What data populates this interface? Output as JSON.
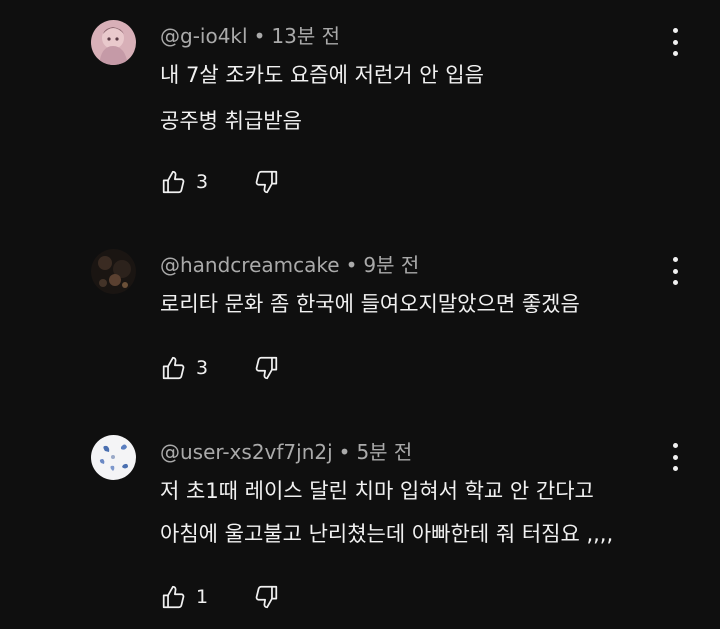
{
  "comments": [
    {
      "handle": "@g-io4kl",
      "separator": "•",
      "time": "13분 전",
      "lines": [
        "내 7살 조카도 요즘에 저런거 안 입음",
        "공주병 취급받음"
      ],
      "likes": "3",
      "avatar_icon": "pink-anime-avatar"
    },
    {
      "handle": "@handcreamcake",
      "separator": "•",
      "time": "9분 전",
      "lines": [
        "로리타 문화 좀 한국에 들여오지말았으면 좋겠음"
      ],
      "likes": "3",
      "avatar_icon": "dark-photo-avatar"
    },
    {
      "handle": "@user-xs2vf7jn2j",
      "separator": "•",
      "time": "5분 전",
      "lines": [
        "저 초1때 레이스 달린 치마 입혀서 학교 안 간다고",
        "아침에 울고불고 난리쳤는데 아빠한테 줘 터짐요 ,,,,"
      ],
      "likes": "1",
      "avatar_icon": "white-butterfly-avatar"
    }
  ],
  "icons": {
    "like": "thumbs-up-icon",
    "dislike": "thumbs-down-icon",
    "more": "more-vertical-icon"
  },
  "colors": {
    "background": "#0f0f0f",
    "primary_text": "#f1f1f1",
    "secondary_text": "#aaaaaa"
  }
}
